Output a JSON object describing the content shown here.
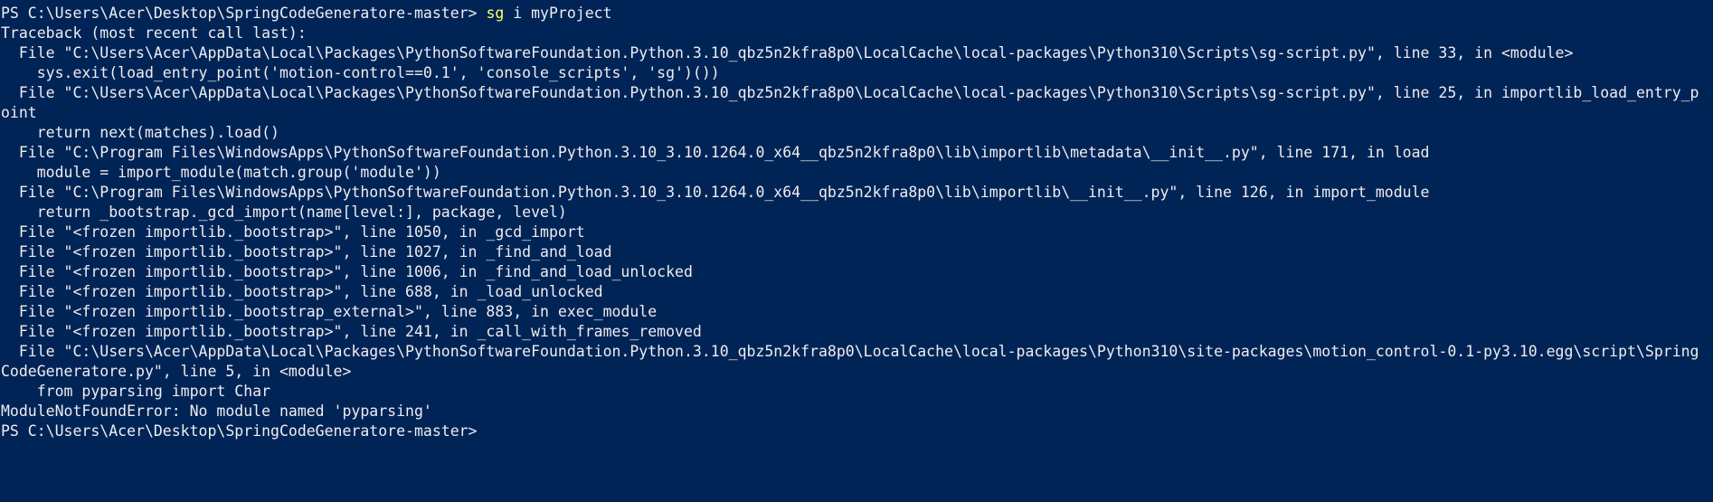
{
  "terminal": {
    "background": "#012456",
    "foreground": "#EEEDF0",
    "command_color": "#FFFF60",
    "prompt1": "PS C:\\Users\\Acer\\Desktop\\SpringCodeGeneratore-master> ",
    "cmd_name": "sg",
    "cmd_args": " i myProject",
    "output": [
      "Traceback (most recent call last):",
      "  File \"C:\\Users\\Acer\\AppData\\Local\\Packages\\PythonSoftwareFoundation.Python.3.10_qbz5n2kfra8p0\\LocalCache\\local-packages\\Python310\\Scripts\\sg-script.py\", line 33, in <module>",
      "    sys.exit(load_entry_point('motion-control==0.1', 'console_scripts', 'sg')())",
      "  File \"C:\\Users\\Acer\\AppData\\Local\\Packages\\PythonSoftwareFoundation.Python.3.10_qbz5n2kfra8p0\\LocalCache\\local-packages\\Python310\\Scripts\\sg-script.py\", line 25, in importlib_load_entry_p",
      "oint",
      "    return next(matches).load()",
      "  File \"C:\\Program Files\\WindowsApps\\PythonSoftwareFoundation.Python.3.10_3.10.1264.0_x64__qbz5n2kfra8p0\\lib\\importlib\\metadata\\__init__.py\", line 171, in load",
      "    module = import_module(match.group('module'))",
      "  File \"C:\\Program Files\\WindowsApps\\PythonSoftwareFoundation.Python.3.10_3.10.1264.0_x64__qbz5n2kfra8p0\\lib\\importlib\\__init__.py\", line 126, in import_module",
      "    return _bootstrap._gcd_import(name[level:], package, level)",
      "  File \"<frozen importlib._bootstrap>\", line 1050, in _gcd_import",
      "  File \"<frozen importlib._bootstrap>\", line 1027, in _find_and_load",
      "  File \"<frozen importlib._bootstrap>\", line 1006, in _find_and_load_unlocked",
      "  File \"<frozen importlib._bootstrap>\", line 688, in _load_unlocked",
      "  File \"<frozen importlib._bootstrap_external>\", line 883, in exec_module",
      "  File \"<frozen importlib._bootstrap>\", line 241, in _call_with_frames_removed",
      "  File \"C:\\Users\\Acer\\AppData\\Local\\Packages\\PythonSoftwareFoundation.Python.3.10_qbz5n2kfra8p0\\LocalCache\\local-packages\\Python310\\site-packages\\motion_control-0.1-py3.10.egg\\script\\Spring",
      "CodeGeneratore.py\", line 5, in <module>",
      "    from pyparsing import Char",
      "ModuleNotFoundError: No module named 'pyparsing'"
    ],
    "prompt2": "PS C:\\Users\\Acer\\Desktop\\SpringCodeGeneratore-master>"
  }
}
